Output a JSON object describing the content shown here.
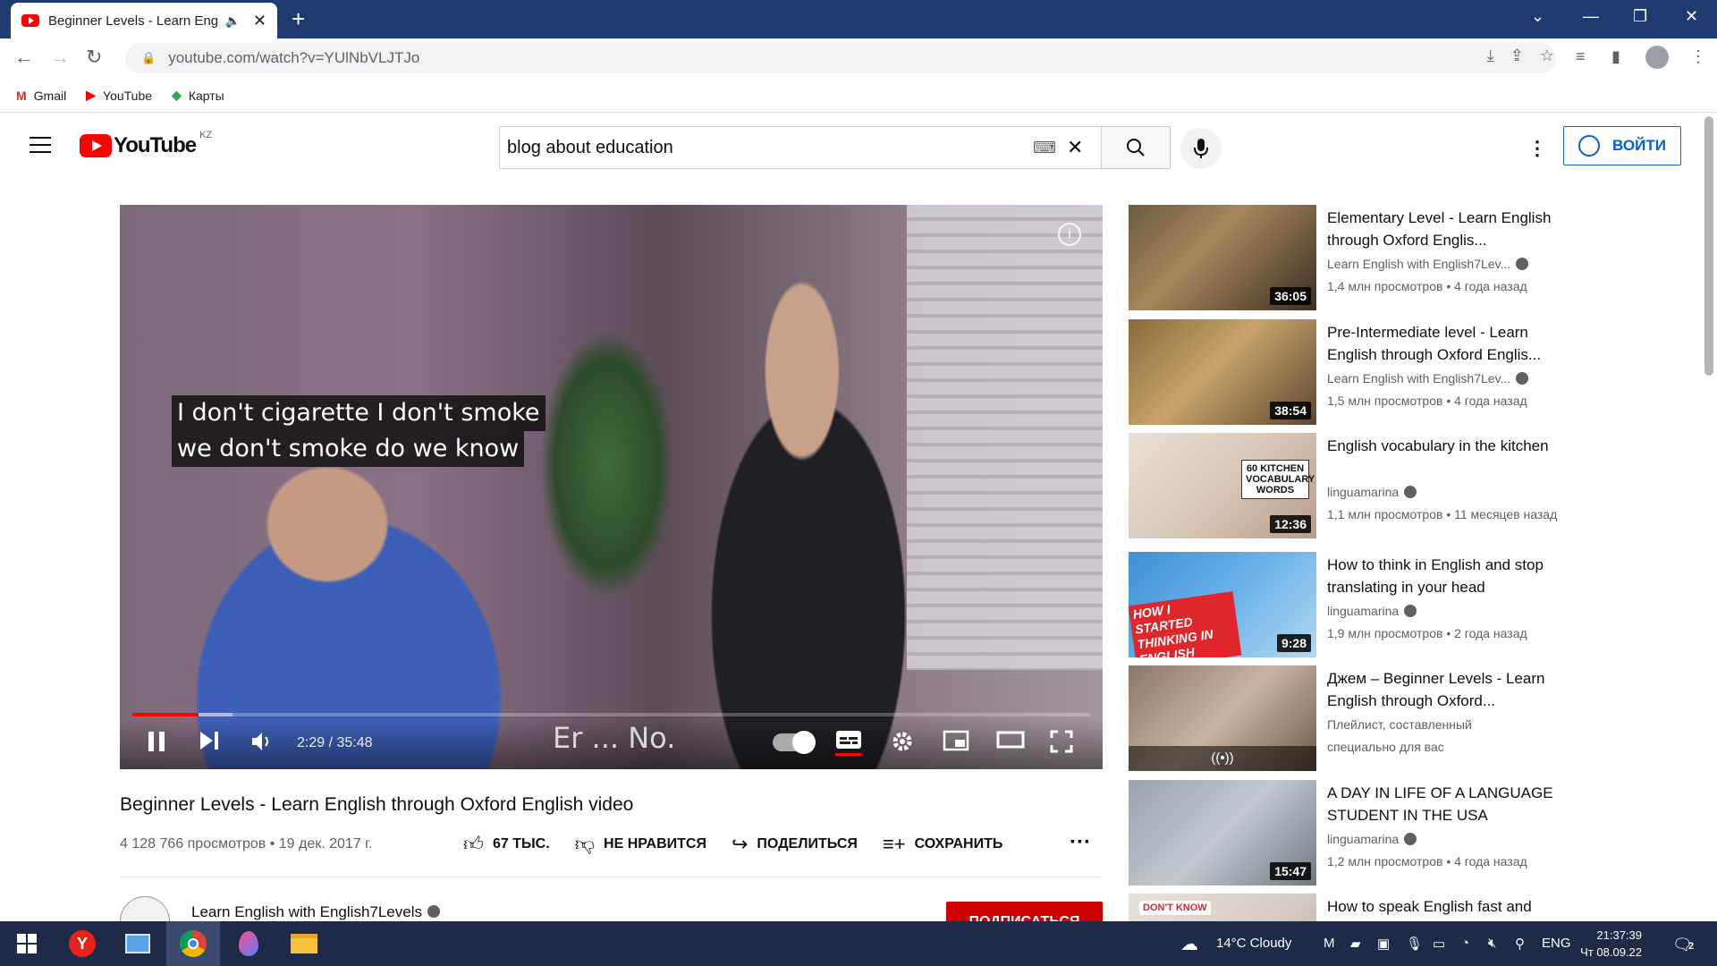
{
  "browser": {
    "tab_title": "Beginner Levels - Learn Engli",
    "audio_icon": "speaker-icon",
    "new_tab": "+",
    "url": "youtube.com/watch?v=YUlNbVLJTJo",
    "bookmarks": [
      {
        "label": "Gmail",
        "icon": "gmail-icon"
      },
      {
        "label": "YouTube",
        "icon": "youtube-icon"
      },
      {
        "label": "Карты",
        "icon": "maps-icon"
      }
    ]
  },
  "youtube": {
    "logo_word": "YouTube",
    "country_code": "KZ",
    "search_value": "blog about education",
    "signin_label": "ВОЙТИ",
    "brand_color": "#ff0000",
    "link_color": "#065fd4"
  },
  "player": {
    "subtitle_line1": "I don't cigarette I don't smoke",
    "subtitle_line2": "we don't smoke do we know",
    "aside_caption": "Er ... No.",
    "time": "2:29 / 35:48",
    "progress_fraction": 0.0694,
    "buffered_fraction": 0.105
  },
  "video": {
    "title": "Beginner Levels - Learn English through Oxford English video",
    "stats": "4 128 766 просмотров • 19 дек. 2017 г.",
    "like_label": "67 ТЫС.",
    "dislike_label": "НЕ НРАВИТСЯ",
    "share_label": "ПОДЕЛИТЬСЯ",
    "save_label": "СОХРАНИТЬ",
    "channel": "Learn English with English7Levels",
    "subscribe_label": "ПОДПИСАТЬСЯ"
  },
  "recommendations": [
    {
      "title": "Elementary Level - Learn English through Oxford Englis...",
      "channel": "Learn English with English7Lev...",
      "verified": true,
      "meta": "1,4 млн просмотров • 4 года назад",
      "duration": "36:05"
    },
    {
      "title": "Pre-Intermediate level - Learn English through Oxford Englis...",
      "channel": "Learn English with English7Lev...",
      "verified": true,
      "meta": "1,5 млн просмотров • 4 года назад",
      "duration": "38:54"
    },
    {
      "title": "English vocabulary in the kitchen",
      "channel": "linguamarina",
      "verified": true,
      "meta": "1,1 млн просмотров • 11 месяцев назад",
      "duration": "12:36",
      "badge": "60 KITCHEN VOCABULARY WORDS"
    },
    {
      "title": "How to think in English and stop translating in your head",
      "channel": "linguamarina",
      "verified": true,
      "meta": "1,9 млн просмотров • 2 года назад",
      "duration": "9:28",
      "badge": "HOW I STARTED THINKING IN ENGLISH"
    },
    {
      "title": "Джем – Beginner Levels - Learn English through Oxford...",
      "channel": "Плейлист, составленный",
      "verified": false,
      "meta": "специально для вас",
      "duration": ""
    },
    {
      "title": "A DAY IN LIFE OF A LANGUAGE STUDENT IN THE USA",
      "channel": "linguamarina",
      "verified": true,
      "meta": "1,2 млн просмотров • 4 года назад",
      "duration": "15:47"
    },
    {
      "title": "How to speak English fast and",
      "channel": "",
      "verified": false,
      "meta": "",
      "duration": "",
      "badge": "DON'T KNOW"
    }
  ],
  "taskbar": {
    "weather": "14°C  Cloudy",
    "lang": "ENG",
    "time": "21:37:39",
    "date": "Чт 08.09.22",
    "notifications": "2"
  }
}
